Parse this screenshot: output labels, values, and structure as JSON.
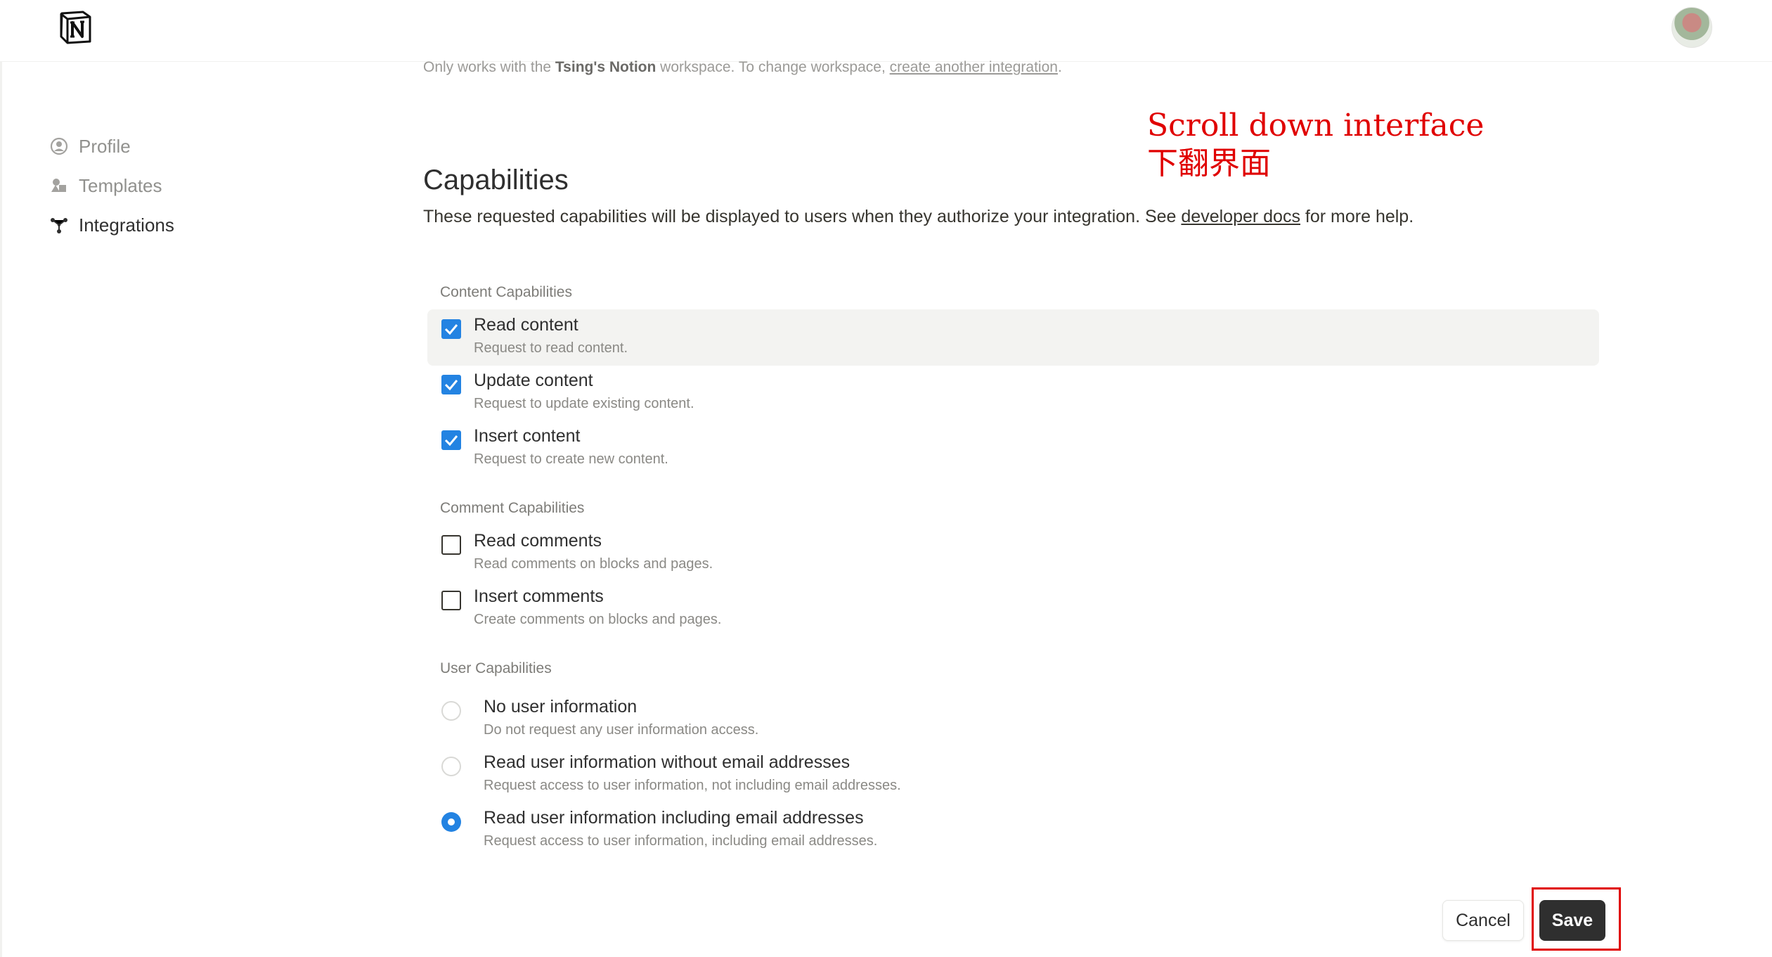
{
  "header": {
    "logo_icon": "notion-logo-icon",
    "avatar_icon": "user-avatar"
  },
  "sidebar": {
    "items": [
      {
        "label": "Profile",
        "icon": "profile-icon",
        "active": false
      },
      {
        "label": "Templates",
        "icon": "templates-icon",
        "active": false
      },
      {
        "label": "Integrations",
        "icon": "integrations-icon",
        "active": true
      }
    ]
  },
  "workspace_note": {
    "prefix": "Only works with the ",
    "workspace": "Tsing's Notion",
    "middle": " workspace. To change workspace, ",
    "link": "create another integration",
    "suffix": "."
  },
  "capabilities": {
    "title": "Capabilities",
    "desc_prefix": "These requested capabilities will be displayed to users when they authorize your integration. See ",
    "desc_link": "developer docs",
    "desc_suffix": " for more help.",
    "content": {
      "label": "Content Capabilities",
      "options": [
        {
          "label": "Read content",
          "sub": "Request to read content.",
          "checked": true
        },
        {
          "label": "Update content",
          "sub": "Request to update existing content.",
          "checked": true
        },
        {
          "label": "Insert content",
          "sub": "Request to create new content.",
          "checked": true
        }
      ]
    },
    "comment": {
      "label": "Comment Capabilities",
      "options": [
        {
          "label": "Read comments",
          "sub": "Read comments on blocks and pages.",
          "checked": false
        },
        {
          "label": "Insert comments",
          "sub": "Create comments on blocks and pages.",
          "checked": false
        }
      ]
    },
    "user": {
      "label": "User Capabilities",
      "options": [
        {
          "label": "No user information",
          "sub": "Do not request any user information access.",
          "selected": false
        },
        {
          "label": "Read user information without email addresses",
          "sub": "Request access to user information, not including email addresses.",
          "selected": false
        },
        {
          "label": "Read user information including email addresses",
          "sub": "Request access to user information, including email addresses.",
          "selected": true
        }
      ]
    }
  },
  "annotation": {
    "line1": "Scroll down interface",
    "line2": "下翻界面",
    "color": "#e00000"
  },
  "footer": {
    "cancel_label": "Cancel",
    "save_label": "Save"
  },
  "colors": {
    "accent": "#2383e2",
    "save_bg": "#2f2f2f"
  }
}
